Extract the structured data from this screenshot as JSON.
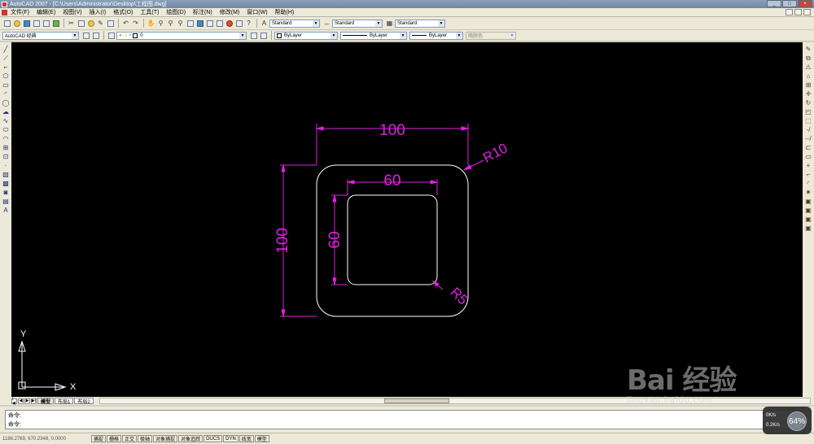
{
  "window": {
    "title": "AutoCAD 2007 - [C:\\Users\\Administrator\\Desktop\\工程图.dwg]",
    "controls": [
      "_",
      "□",
      "×"
    ]
  },
  "menubar": {
    "items": [
      "文件(F)",
      "编辑(E)",
      "视图(V)",
      "插入(I)",
      "格式(O)",
      "工具(T)",
      "绘图(D)",
      "标注(N)",
      "修改(M)",
      "窗口(W)",
      "帮助(H)"
    ]
  },
  "toolbar": {
    "text_style": "Standard",
    "dim_style": "Standard",
    "table_style": "Standard",
    "workspace": "AutoCAD 经典",
    "layer": "0",
    "color": "ByLayer",
    "linetype": "ByLayer",
    "lineweight": "ByLayer",
    "plotstyle": "随颜色"
  },
  "drawing": {
    "background": "#000000",
    "geometry_color": "#ffffff",
    "dim_color": "#e020e0",
    "dims": {
      "outer_width": "100",
      "outer_height": "100",
      "inner_width": "60",
      "inner_height": "60",
      "outer_radius": "R10",
      "inner_radius": "R5"
    },
    "ucs": {
      "x_label": "X",
      "y_label": "Y"
    }
  },
  "layout_tabs": {
    "nav": [
      "|◀",
      "◀",
      "▶",
      "▶|"
    ],
    "tabs": [
      "模型",
      "布局1",
      "布局2"
    ]
  },
  "command": {
    "line1": "命令:",
    "line2": "命令:"
  },
  "status": {
    "coords": "1186.2769, 670.2348, 0.0000",
    "buttons": [
      "捕捉",
      "栅格",
      "正交",
      "极轴",
      "对象捕捉",
      "对象追踪",
      "DUCS",
      "DYN",
      "线宽",
      "模型"
    ]
  },
  "speed_widget": {
    "percent": "64%",
    "up": "0K/s",
    "down": "0.2K/s"
  },
  "watermark": {
    "brand": "Bai 经验",
    "site": "jingyan.baidu.com"
  }
}
